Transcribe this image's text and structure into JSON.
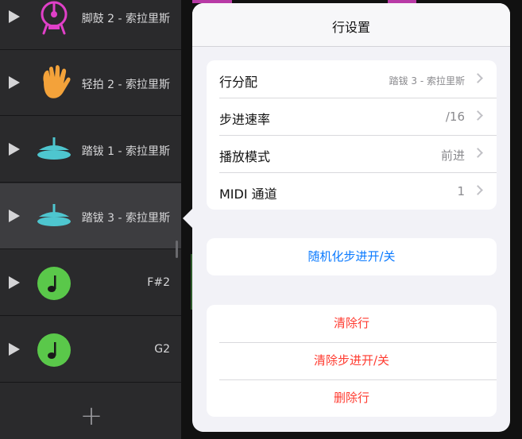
{
  "tracks": [
    {
      "name": "脚鼓 2 - 索拉里斯",
      "icon": "kick-drum-icon",
      "color": "#e040c8"
    },
    {
      "name": "轻拍 2 - 索拉里斯",
      "icon": "hand-clap-icon",
      "color": "#f3a23a"
    },
    {
      "name": "踏钹 1 - 索拉里斯",
      "icon": "hi-hat-icon",
      "color": "#4ec6cf"
    },
    {
      "name": "踏钹 3 - 索拉里斯",
      "icon": "hi-hat-icon",
      "color": "#4ec6cf",
      "selected": true
    },
    {
      "name": "F#2",
      "icon": "music-note-icon",
      "color": "#5ac84a"
    },
    {
      "name": "G2",
      "icon": "music-note-icon",
      "color": "#5ac84a"
    }
  ],
  "add_track_label": "+",
  "popover": {
    "title": "行设置",
    "settings": [
      {
        "label": "行分配",
        "value": "踏钹 3 - 索拉里斯"
      },
      {
        "label": "步进速率",
        "value": "/16"
      },
      {
        "label": "播放模式",
        "value": "前进"
      },
      {
        "label": "MIDI 通道",
        "value": "1"
      }
    ],
    "randomize_label": "随机化步进开/关",
    "actions": [
      {
        "label": "清除行"
      },
      {
        "label": "清除步进开/关"
      },
      {
        "label": "删除行"
      }
    ]
  },
  "colors": {
    "accent_blue": "#0a7aff",
    "destructive_red": "#ff3b30"
  }
}
